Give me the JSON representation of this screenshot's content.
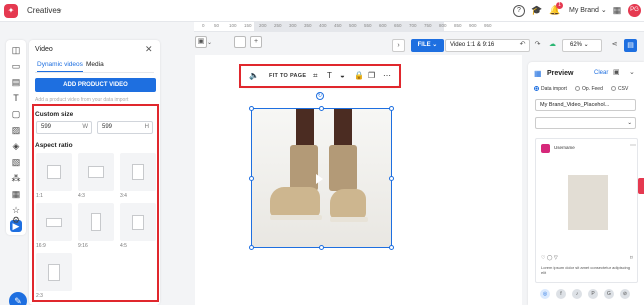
{
  "topbar": {
    "breadcrumb": "Creatives",
    "brand": "My Brand",
    "notifications": "1",
    "avatar": "PG"
  },
  "ruler": [
    "0",
    "50",
    "100",
    "150",
    "200",
    "250",
    "300",
    "350",
    "400",
    "450",
    "500",
    "550",
    "600",
    "650",
    "700",
    "750",
    "800",
    "850",
    "900",
    "950"
  ],
  "left_panel": {
    "title": "Video",
    "tabs": [
      "Dynamic videos",
      "Media"
    ],
    "add_button": "ADD PRODUCT VIDEO",
    "hint": "Add a product video from your data import",
    "custom_size": {
      "title": "Custom size",
      "width": "599",
      "width_unit": "W",
      "height": "599",
      "height_unit": "H"
    },
    "aspect_ratio": {
      "title": "Aspect ratio",
      "options": [
        "1:1",
        "4:3",
        "3:4",
        "16:9",
        "9:16",
        "4:5",
        "2:3"
      ]
    }
  },
  "float_toolbar": {
    "fit_label": "FIT TO PAGE"
  },
  "right_toolbar": {
    "file": "FILE",
    "name": "Video 1:1 & 9:16",
    "zoom": "62%"
  },
  "preview": {
    "title": "Preview",
    "clear": "Clear",
    "sources": [
      "Data import",
      "Op. Feed",
      "CSV"
    ],
    "selected_source": "Data import",
    "feed_select": "My Brand_Video_Placehol...",
    "second_select": "",
    "username": "Username",
    "caption": "Lorem ipsum dolor sit amet consectetur adipiscing elit"
  },
  "colors": {
    "accent": "#1e6fe0",
    "highlight": "#e0272d",
    "brand": "#e53950"
  }
}
